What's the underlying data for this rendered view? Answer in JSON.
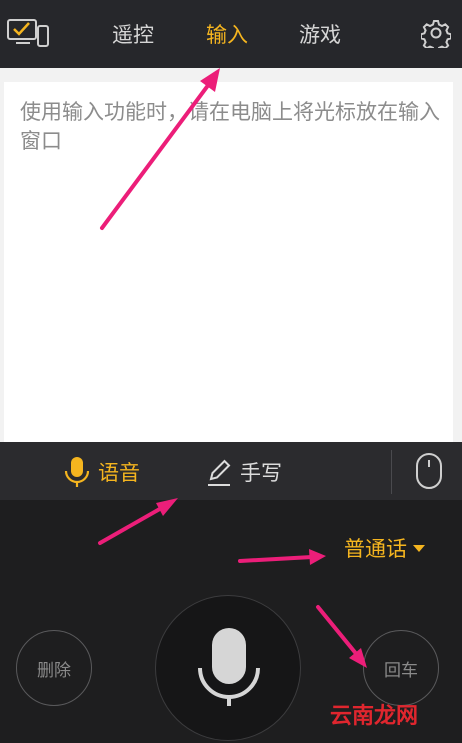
{
  "header": {
    "tabs": [
      {
        "label": "遥控"
      },
      {
        "label": "输入"
      },
      {
        "label": "游戏"
      }
    ],
    "active_tab": "输入",
    "icons": [
      "device-icon",
      "gear-icon"
    ]
  },
  "text_area": {
    "placeholder": "使用输入功能时，请在电脑上将光标放在输入窗口"
  },
  "input_modes": {
    "voice_label": "语音",
    "handwrite_label": "手写",
    "active": "语音"
  },
  "voice_panel": {
    "language": "普通话",
    "delete_label": "删除",
    "enter_label": "回车"
  },
  "watermark": "云南龙网",
  "colors": {
    "accent": "#f5b51f",
    "annotation_arrow": "#ec1e79",
    "watermark": "#e0262e"
  }
}
